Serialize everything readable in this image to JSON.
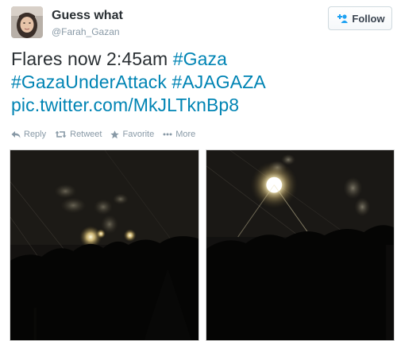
{
  "user": {
    "display_name": "Guess what",
    "handle": "@Farah_Gazan",
    "avatar_icon": "profile-photo"
  },
  "follow_button": {
    "label": "Follow",
    "icon": "add-user-icon"
  },
  "tweet": {
    "line1_text": "Flares now 2:45am ",
    "line1_hashtag": "#Gaza",
    "line2_hashtag1": "#GazaUnderAttack",
    "line2_hashtag2": "#AJAGAZA",
    "line3_link": "pic.twitter.com/MkJLTknBp8"
  },
  "actions": {
    "reply": "Reply",
    "retweet": "Retweet",
    "favorite": "Favorite",
    "more": "More"
  },
  "colors": {
    "link": "#0084b4",
    "meta": "#8899a6",
    "text": "#292f33"
  },
  "photos": [
    {
      "icon": "night-flares-photo"
    },
    {
      "icon": "night-flare-photo"
    }
  ]
}
